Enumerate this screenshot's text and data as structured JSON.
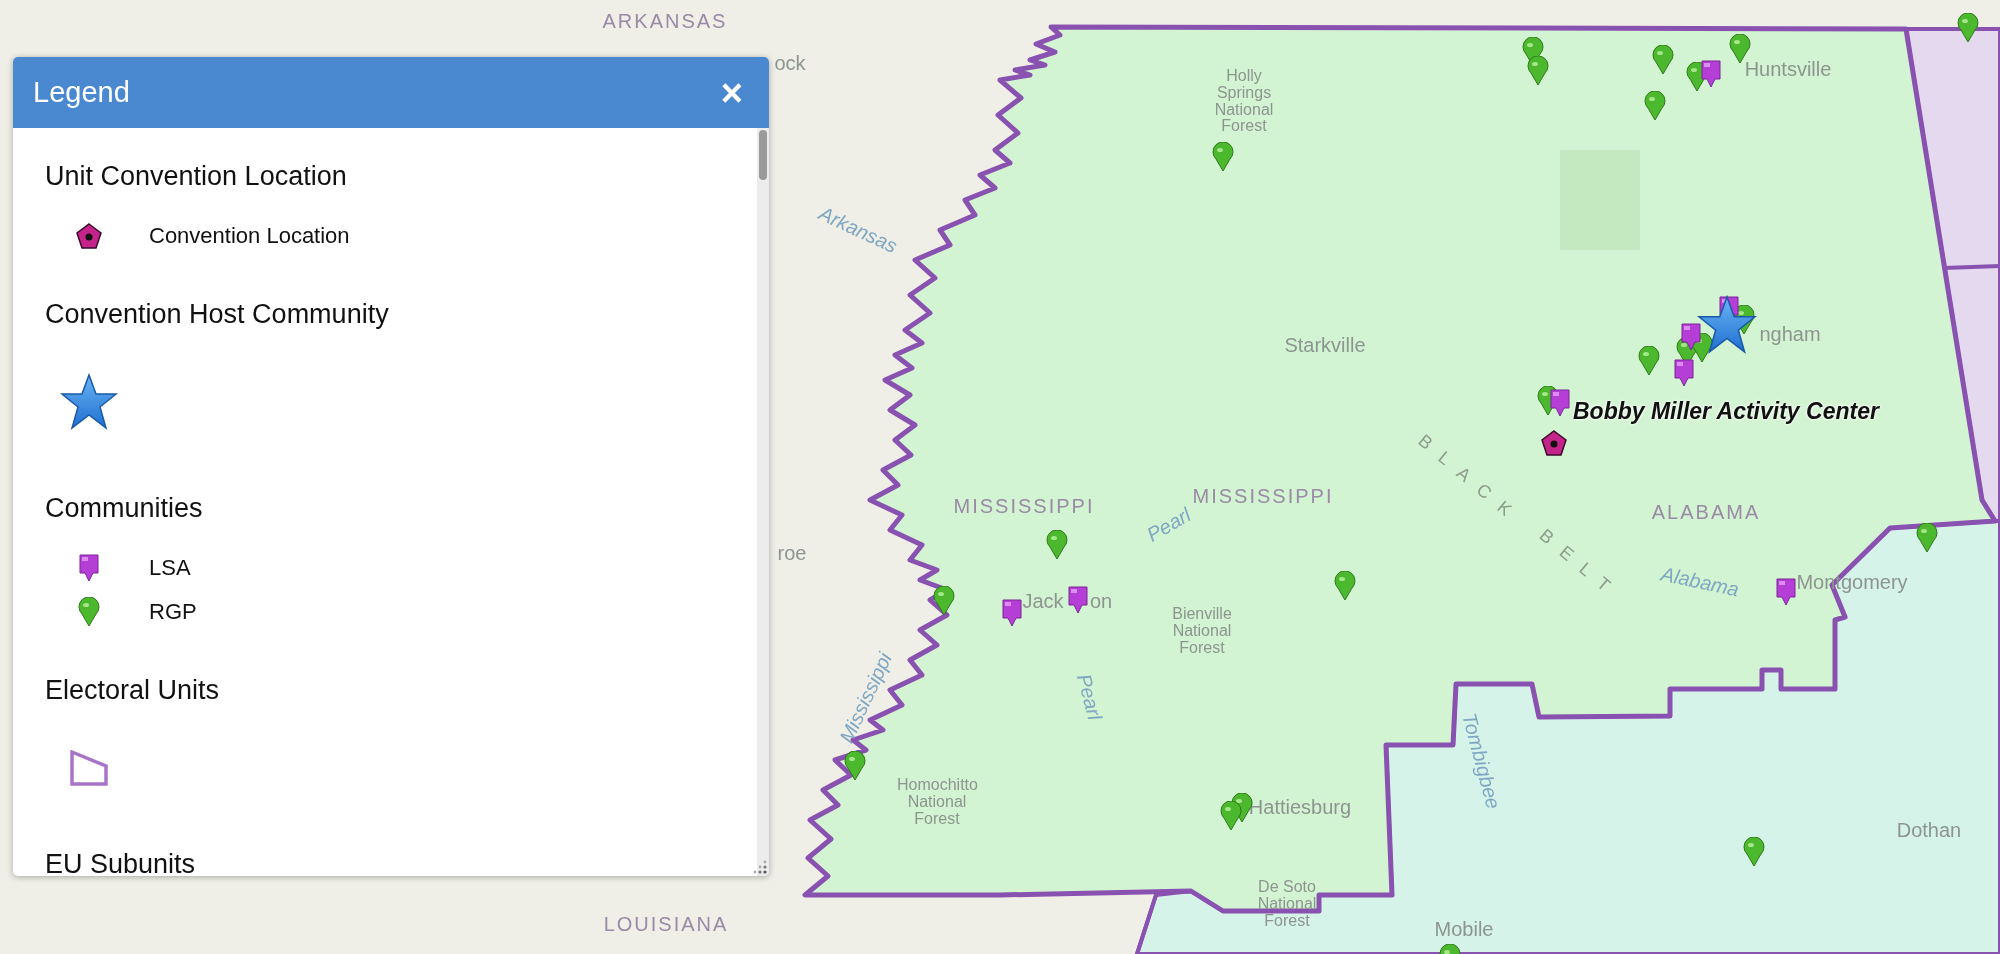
{
  "legend": {
    "title": "Legend",
    "close": "×",
    "sections": [
      {
        "title": "Unit Convention Location",
        "items": [
          {
            "kind": "pentagon",
            "label": "Convention Location"
          }
        ]
      },
      {
        "title": "Convention Host Community",
        "items": [
          {
            "kind": "star"
          }
        ]
      },
      {
        "title": "Communities",
        "items": [
          {
            "kind": "flagpin",
            "label": "LSA"
          },
          {
            "kind": "roundpin",
            "label": "RGP"
          }
        ]
      },
      {
        "title": "Electoral Units",
        "items": [
          {
            "kind": "polygon"
          }
        ]
      },
      {
        "title": "EU Subunits"
      }
    ]
  },
  "map": {
    "callout": "Bobby Miller Activity Center",
    "labels": [
      {
        "kind": "state",
        "text": "ARKANSAS"
      },
      {
        "kind": "city",
        "text": "ock"
      },
      {
        "kind": "river",
        "text": "Arkansas"
      },
      {
        "kind": "city",
        "text": "roe"
      },
      {
        "kind": "forest",
        "text": "Holly Springs National Forest"
      },
      {
        "kind": "city",
        "text": "Huntsville"
      },
      {
        "kind": "city",
        "text": "Starkville"
      },
      {
        "kind": "city",
        "text": "ngham"
      },
      {
        "kind": "state",
        "text": "MISSISSIPPI"
      },
      {
        "kind": "state",
        "text": "MISSISSIPPI"
      },
      {
        "kind": "state",
        "text": "ALABAMA"
      },
      {
        "kind": "region",
        "text": "BLACK"
      },
      {
        "kind": "region",
        "text": "BELT"
      },
      {
        "kind": "river",
        "text": "Pearl"
      },
      {
        "kind": "city",
        "text": "Jack"
      },
      {
        "kind": "city",
        "text": "on"
      },
      {
        "kind": "forest",
        "text": "Bienville National Forest"
      },
      {
        "kind": "river",
        "text": "Pearl"
      },
      {
        "kind": "river",
        "text": "Alabama"
      },
      {
        "kind": "city",
        "text": "Montgomery"
      },
      {
        "kind": "river",
        "text": "Mississippi"
      },
      {
        "kind": "forest",
        "text": "Homochitto National Forest"
      },
      {
        "kind": "city",
        "text": "Hattiesburg"
      },
      {
        "kind": "river",
        "text": "Tombigbee"
      },
      {
        "kind": "city",
        "text": "Dothan"
      },
      {
        "kind": "state",
        "text": "LOUISIANA"
      },
      {
        "kind": "forest",
        "text": "De Soto National Forest"
      },
      {
        "kind": "city",
        "text": "Mobile"
      }
    ]
  }
}
